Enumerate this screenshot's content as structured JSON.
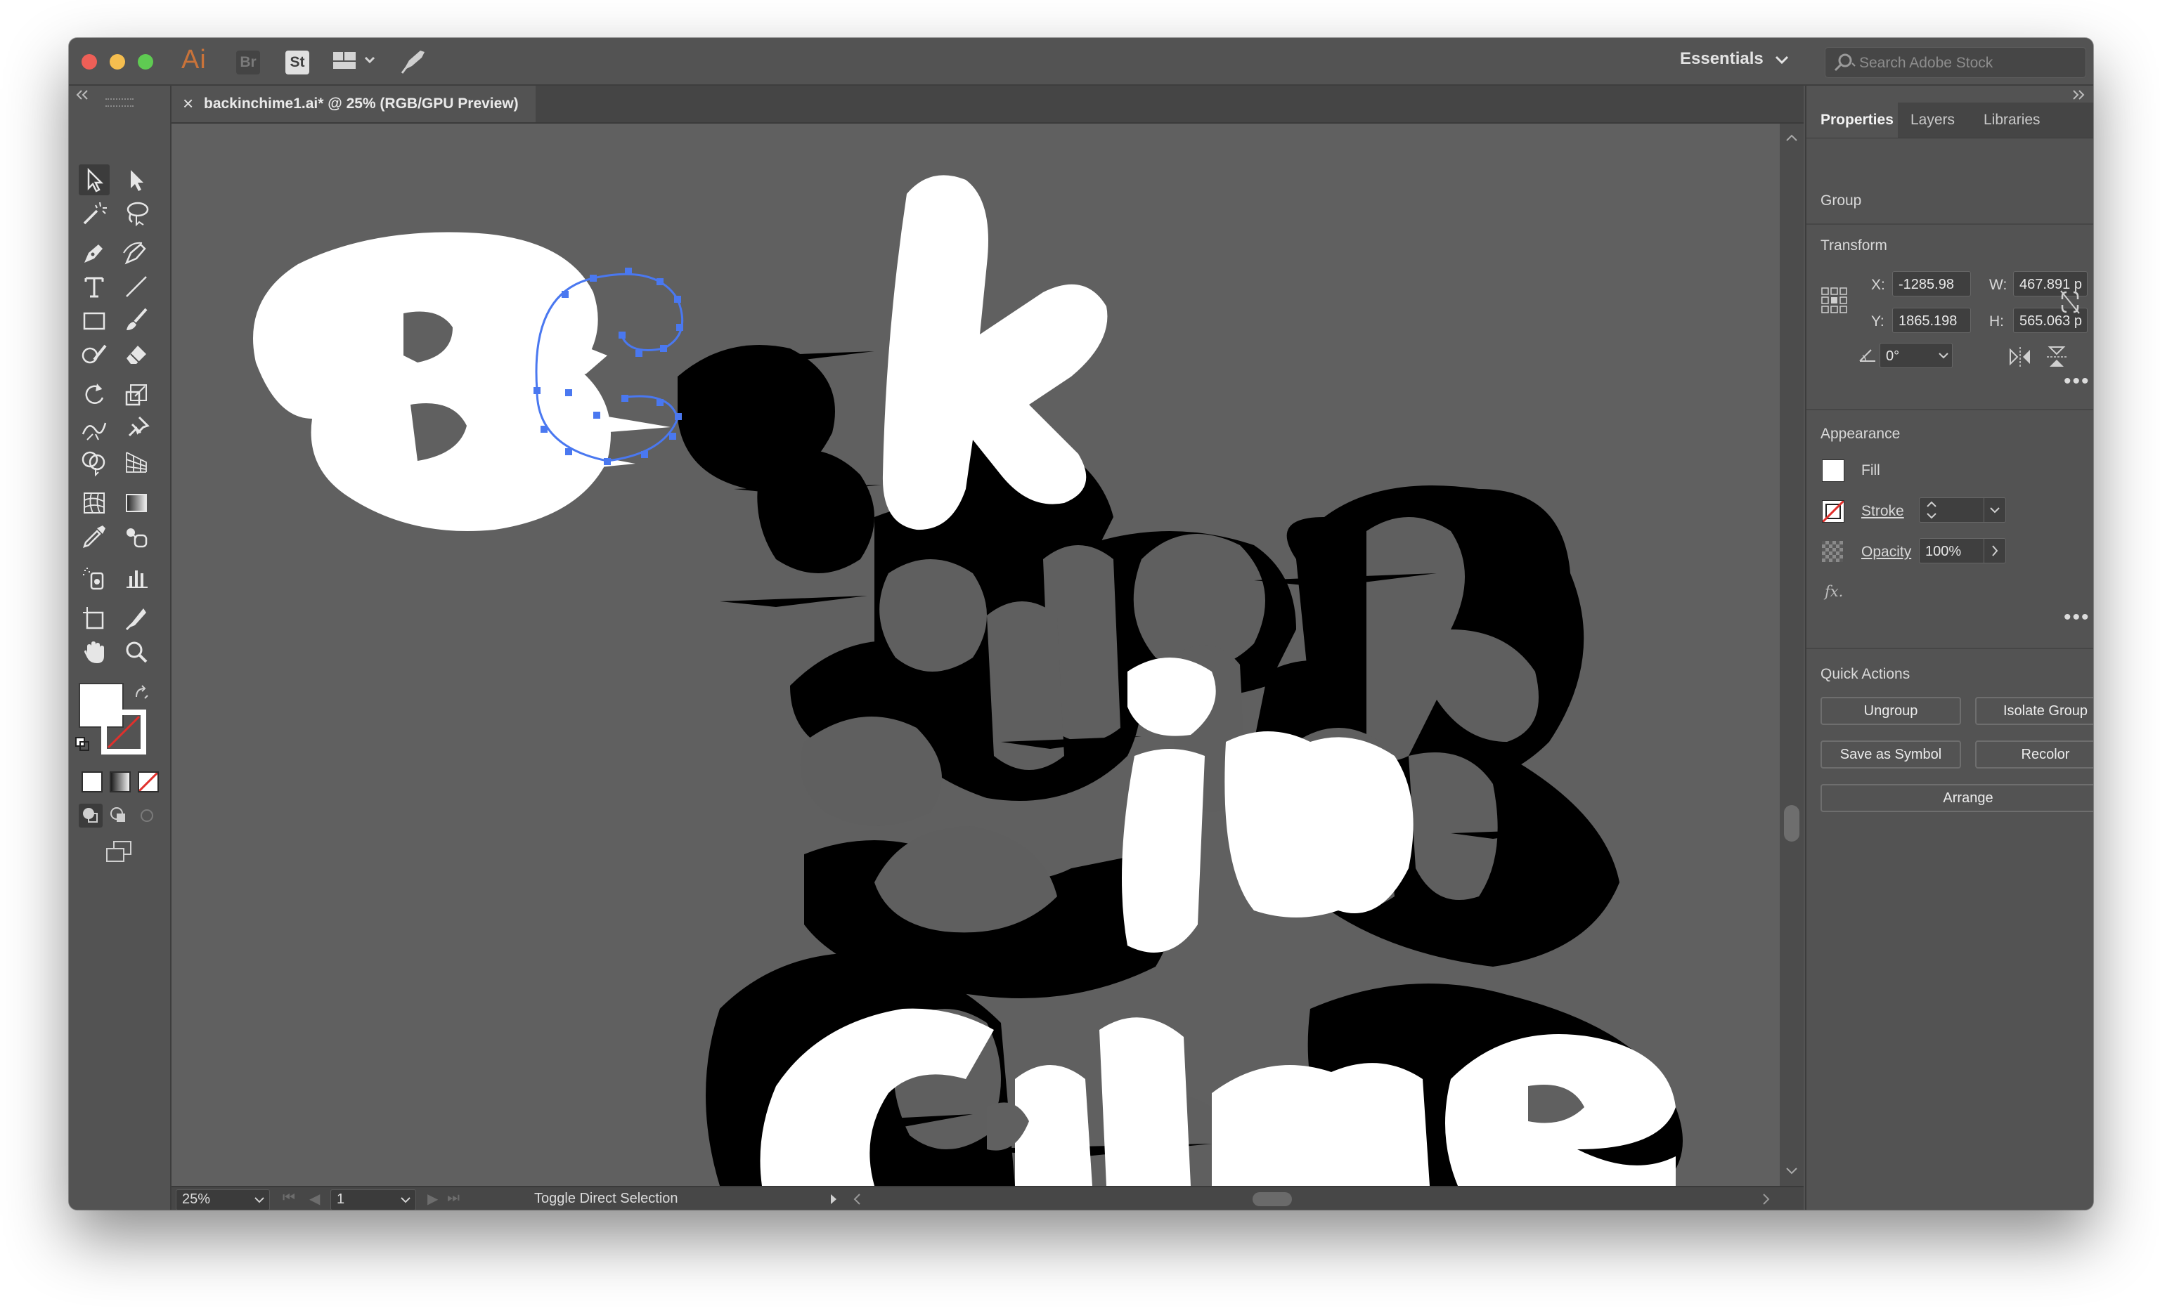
{
  "app": {
    "logo": "Ai",
    "bridge_chip": "Br",
    "stock_chip": "St",
    "workspace_label": "Essentials",
    "search_placeholder": "Search Adobe Stock"
  },
  "document": {
    "tab_title": "backinchime1.ai* @ 25% (RGB/GPU Preview)",
    "close_glyph": "×"
  },
  "canvas_art": {
    "letters": [
      "B",
      "c",
      "k",
      "a",
      "c",
      "k",
      "i",
      "n",
      "t",
      "i",
      "m",
      "e",
      "C",
      "h",
      "i",
      "m",
      "e"
    ]
  },
  "statusbar": {
    "zoom": "25%",
    "artboard": "1",
    "status_text": "Toggle Direct Selection"
  },
  "panel": {
    "tabs": [
      {
        "label": "Properties",
        "active": true
      },
      {
        "label": "Layers",
        "active": false
      },
      {
        "label": "Libraries",
        "active": false
      }
    ],
    "selection_type": "Group",
    "transform": {
      "title": "Transform",
      "x_label": "X:",
      "x_value": "-1285.98",
      "y_label": "Y:",
      "y_value": "1865.198",
      "w_label": "W:",
      "w_value": "467.891 p",
      "h_label": "H:",
      "h_value": "565.063 p",
      "angle_value": "0°"
    },
    "appearance": {
      "title": "Appearance",
      "fill_label": "Fill",
      "stroke_label": "Stroke",
      "opacity_label": "Opacity",
      "opacity_value": "100%",
      "fx_label": "fx."
    },
    "quick_actions": {
      "title": "Quick Actions",
      "ungroup": "Ungroup",
      "isolate_group": "Isolate Group",
      "save_as_symbol": "Save as Symbol",
      "recolor": "Recolor",
      "arrange": "Arrange"
    }
  },
  "colors": {
    "chrome": "#535353",
    "canvas": "#606060",
    "selection": "#4a78f0",
    "close_red": "#ee5f57",
    "minimize_yellow": "#f5be4f",
    "zoom_green": "#5fcb52",
    "ai_orange": "#c9733a"
  }
}
